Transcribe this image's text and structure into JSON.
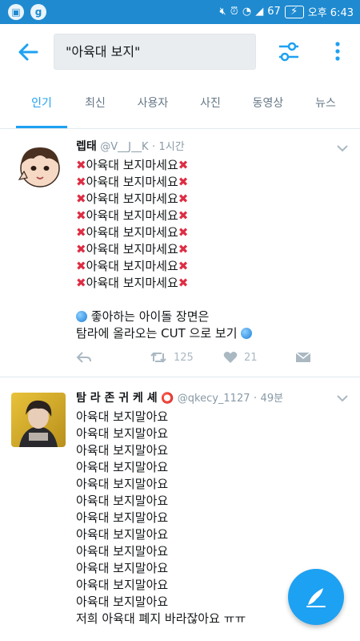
{
  "status_bar": {
    "signal": "67",
    "time_label": "오후 6:43",
    "icons": [
      "app-icon",
      "g-icon",
      "mute-icon",
      "alarm-icon",
      "wifi-icon",
      "signal-icon",
      "battery-icon"
    ]
  },
  "search": {
    "query": "\"아육대 보지\""
  },
  "tabs": [
    {
      "label": "인기",
      "active": true
    },
    {
      "label": "최신",
      "active": false
    },
    {
      "label": "사용자",
      "active": false
    },
    {
      "label": "사진",
      "active": false
    },
    {
      "label": "동영상",
      "active": false
    },
    {
      "label": "뉴스",
      "active": false
    }
  ],
  "tweets": [
    {
      "name": "렙태",
      "handle": "@V__J__K",
      "time": "1시간",
      "lines": [
        "아육대 보지마세요",
        "아육대 보지마세요",
        "아육대 보지마세요",
        "아육대 보지마세요",
        "아육대 보지마세요",
        "아육대 보지마세요",
        "아육대 보지마세요",
        "아육대 보지마세요"
      ],
      "extra_lines": [
        "좋아하는 아이돌 장면은",
        "탐라에 올라오는 CUT 으로 보기"
      ],
      "retweets": "125",
      "likes": "21"
    },
    {
      "name": "탐 라 존 귀 케 셰",
      "handle": "@qkecy_1127",
      "time": "49분",
      "lines": [
        "아육대 보지말아요",
        "아육대 보지말아요",
        "아육대 보지말아요",
        "아육대 보지말아요",
        "아육대 보지말아요",
        "아육대 보지말아요",
        "아육대 보지말아요",
        "아육대 보지말아요",
        "아육대 보지말아요",
        "아육대 보지말아요",
        "아육대 보지말아요",
        "아육대 보지말아요",
        "저희 아육대 폐지 바라잖아요 ㅠㅠ"
      ]
    }
  ],
  "colors": {
    "status_bar": "#1f8ad0",
    "accent": "#1da1f2",
    "x_mark": "#dd2e44"
  }
}
